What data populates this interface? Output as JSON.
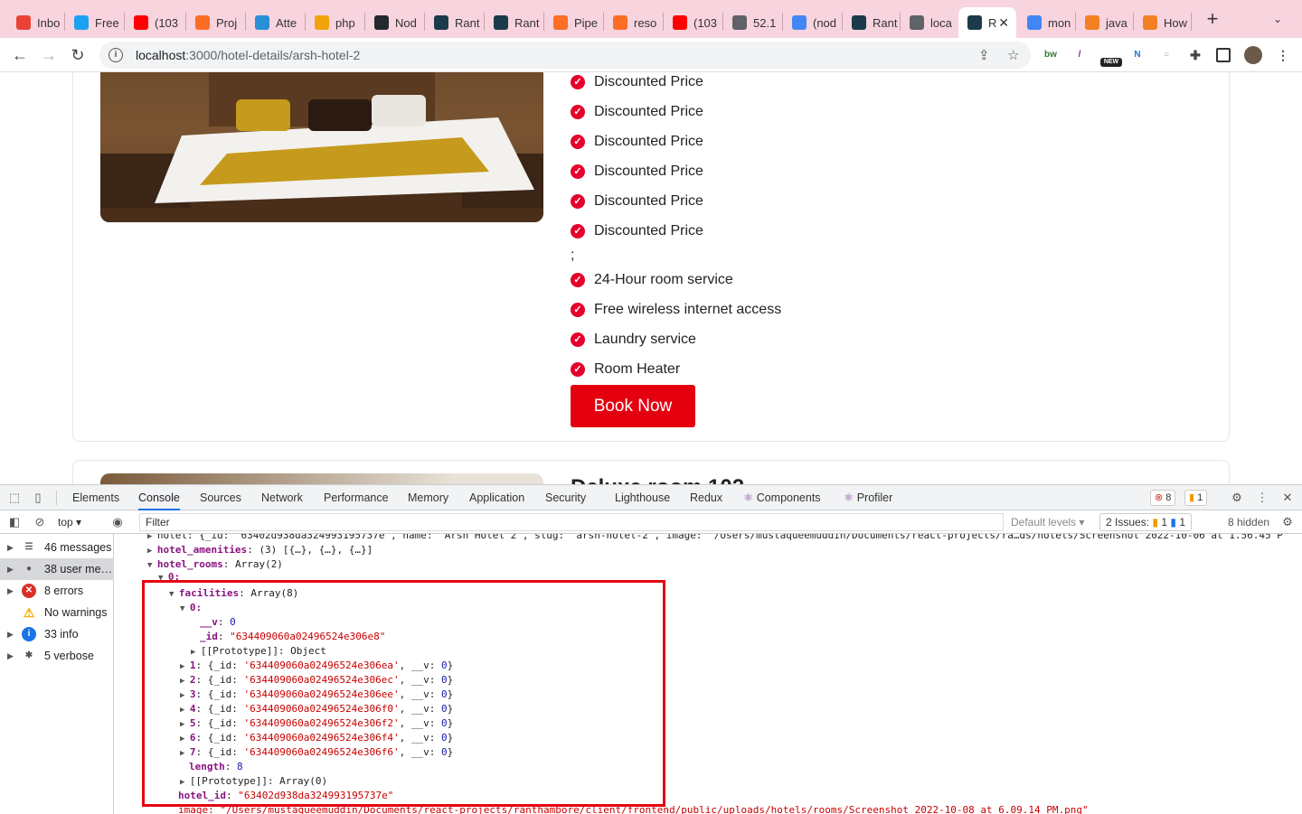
{
  "browser": {
    "tabs": [
      {
        "label": "Inbo",
        "icon": "gmail-icon",
        "color": "#ea4335"
      },
      {
        "label": "Free",
        "icon": "twitter-icon",
        "color": "#1da1f2"
      },
      {
        "label": "(103",
        "icon": "youtube-icon",
        "color": "#ff0000"
      },
      {
        "label": "Proj",
        "icon": "gitlab-icon",
        "color": "#fc6d26"
      },
      {
        "label": "Atte",
        "icon": "app-icon",
        "color": "#2a8fd6"
      },
      {
        "label": "php",
        "icon": "phpmyadmin-icon",
        "color": "#f0a30a"
      },
      {
        "label": "Nod",
        "icon": "github-icon",
        "color": "#24292e"
      },
      {
        "label": "Rant",
        "icon": "react-icon",
        "color": "#1b3b4b"
      },
      {
        "label": "Rant",
        "icon": "react-icon",
        "color": "#1b3b4b"
      },
      {
        "label": "Pipe",
        "icon": "gitlab-icon",
        "color": "#fc6d26"
      },
      {
        "label": "reso",
        "icon": "gitlab-icon",
        "color": "#fc6d26"
      },
      {
        "label": "(103",
        "icon": "youtube-icon",
        "color": "#ff0000"
      },
      {
        "label": "52.1",
        "icon": "globe-icon",
        "color": "#5f6368"
      },
      {
        "label": "(nod",
        "icon": "google-icon",
        "color": "#4285f4"
      },
      {
        "label": "Rant",
        "icon": "react-icon",
        "color": "#1b3b4b"
      },
      {
        "label": "loca",
        "icon": "globe-icon",
        "color": "#5f6368"
      },
      {
        "label": "R",
        "icon": "react-icon",
        "color": "#1b3b4b",
        "active": true
      },
      {
        "label": "mon",
        "icon": "google-icon",
        "color": "#4285f4"
      },
      {
        "label": "java",
        "icon": "stackoverflow-icon",
        "color": "#f48024"
      },
      {
        "label": "How",
        "icon": "stackoverflow-icon",
        "color": "#f48024"
      }
    ],
    "url_host": "localhost",
    "url_path": ":3000/hotel-details/arsh-hotel-2",
    "extensions": [
      {
        "name": "bw-extension-icon",
        "label": "bw",
        "color": "#2e7d32"
      },
      {
        "name": "feather-extension-icon",
        "label": "/",
        "color": "#7b1fa2"
      },
      {
        "name": "new-extension-icon",
        "label": "NEW",
        "color": "#222"
      },
      {
        "name": "n-extension-icon",
        "label": "N",
        "color": "#1976d2"
      },
      {
        "name": "circle-extension-icon",
        "label": "○",
        "color": "#999"
      }
    ]
  },
  "page": {
    "features": [
      "Discounted Price",
      "Discounted Price",
      "Discounted Price",
      "Discounted Price",
      "Discounted Price",
      "Discounted Price"
    ],
    "separator": ";",
    "amenities": [
      "24-Hour room service",
      "Free wireless internet access",
      "Laundry service",
      "Room Heater"
    ],
    "book_now": "Book Now",
    "next_card_title": "Deluxe room 102"
  },
  "devtools": {
    "tabs": [
      "Elements",
      "Console",
      "Sources",
      "Network",
      "Performance",
      "Memory",
      "Application",
      "Security",
      "Lighthouse",
      "Redux",
      "Components",
      "Profiler"
    ],
    "active_tab": "Console",
    "errors_count": "8",
    "warnings_count": "1",
    "context": "top",
    "filter_placeholder": "Filter",
    "levels": "Default levels",
    "issues_label": "2 Issues:",
    "issues_warn": "1",
    "issues_info": "1",
    "hidden": "8 hidden",
    "sidebar": [
      {
        "label": "46 messages",
        "icon": "list-icon"
      },
      {
        "label": "38 user me…",
        "icon": "user-icon",
        "selected": true
      },
      {
        "label": "8 errors",
        "icon": "error-icon"
      },
      {
        "label": "No warnings",
        "icon": "warning-icon"
      },
      {
        "label": "33 info",
        "icon": "info-icon"
      },
      {
        "label": "5 verbose",
        "icon": "bug-icon"
      }
    ],
    "console": {
      "hotel_line": "hotel: {_id: '63402d938da324993195737e', name: 'Arsh Hotel 2', slug: 'arsh-hotel-2', image: '/Users/mustaqueemuddin/Documents/react-projects/ra…ds/hotels/Screenshot 2022-10-06 at 1.56.45 P",
      "amenities_key": "hotel_amenities",
      "amenities_val": "(3) [{…}, {…}, {…}]",
      "rooms_key": "hotel_rooms",
      "rooms_val": "Array(2)",
      "index0": "0:",
      "facilities_key": "facilities",
      "facilities_val": "Array(8)",
      "f0_index": "0:",
      "f0_v_key": "__v",
      "f0_v_val": "0",
      "f0_id_key": "_id",
      "f0_id_val": "\"634409060a02496524e306e8\"",
      "proto_object": "[[Prototype]]: Object",
      "facility_items": [
        {
          "idx": "1",
          "id": "'634409060a02496524e306ea'"
        },
        {
          "idx": "2",
          "id": "'634409060a02496524e306ec'"
        },
        {
          "idx": "3",
          "id": "'634409060a02496524e306ee'"
        },
        {
          "idx": "4",
          "id": "'634409060a02496524e306f0'"
        },
        {
          "idx": "5",
          "id": "'634409060a02496524e306f2'"
        },
        {
          "idx": "6",
          "id": "'634409060a02496524e306f4'"
        },
        {
          "idx": "7",
          "id": "'634409060a02496524e306f6'"
        }
      ],
      "length_key": "length",
      "length_val": "8",
      "proto_array": "[[Prototype]]: Array(0)",
      "hotel_id_key": "hotel_id",
      "hotel_id_val": "\"63402d938da324993195737e\"",
      "image_line": "image: \"/Users/mustaqueemuddin/Documents/react-projects/ranthambore/client/frontend/public/uploads/hotels/rooms/Screenshot 2022-10-08 at 6.09.14 PM.png\""
    }
  }
}
